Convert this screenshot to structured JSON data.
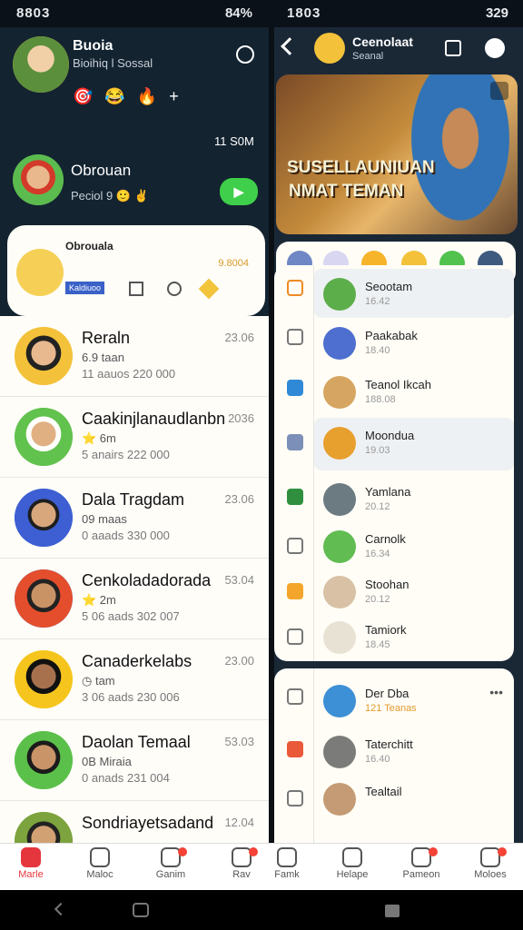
{
  "status": {
    "left_time": "8803",
    "right_time": "1803",
    "battery_left": "84%",
    "battery_right": "329"
  },
  "left_profile": {
    "name": "Buoia",
    "subtitle": "Bioihiq l Sossal",
    "emoji": "🎯 😂 🔥 +",
    "label_right": "11 S0M",
    "name2": "Obrouan",
    "subtitle2": "Peciol 9 🙂 ✌",
    "button": "▶"
  },
  "highlight": {
    "title": "Obrouala",
    "count": "9.8004",
    "tag": "Kaldiuoo"
  },
  "chats": [
    {
      "name": "Reraln",
      "line1": "6.9 taan",
      "line2": "11 aauos 220 000",
      "time": "23.06",
      "color": "#f3c23a"
    },
    {
      "name": "Caakinjlanaudlanbn ,",
      "line1": "⭐ 6m",
      "line2": "5 anairs 222 000",
      "time": "2036",
      "color": "#62c24e"
    },
    {
      "name": "Dala Tragdam",
      "line1": "09 maas",
      "line2": "0 aaads 330 000",
      "time": "23.06",
      "color": "#3d5fd3"
    },
    {
      "name": "Cenkoladadorada",
      "line1": "⭐ 2m",
      "line2": "5 06 aads 302 007",
      "time": "53.04",
      "color": "#2d7fd8"
    },
    {
      "name": "Canaderkelabs",
      "line1": "◷ tam",
      "line2": "3 06 aads 230 006",
      "time": "23.00",
      "color": "#f5c51d"
    },
    {
      "name": "Daolan Temaal",
      "line1": "0B Miraia",
      "line2": "0 anads 231 004",
      "time": "53.03",
      "color": "#5bc04a"
    },
    {
      "name": "Sondriayetsadand",
      "line1": "",
      "line2": "",
      "time": "12.04",
      "color": "#7ca33d"
    }
  ],
  "right_header": {
    "name": "Ceenolaat",
    "subtitle": "Seanal"
  },
  "video": {
    "title1": "SUSELLAUNIUAN",
    "title2": "NMAT TEMAN"
  },
  "contacts": [
    {
      "name": "Seootam",
      "time": "16.42"
    },
    {
      "name": "Paakabak",
      "time": "18.40"
    },
    {
      "name": "Teanol Ikcah",
      "time": "188.08"
    },
    {
      "name": "Moondua",
      "time": "19.03"
    },
    {
      "name": "Yamlana",
      "time": "20.12"
    },
    {
      "name": "Carnolk",
      "time": "16.34"
    },
    {
      "name": "Stoohan",
      "time": "20.12"
    },
    {
      "name": "Tamiork",
      "time": "18.45"
    }
  ],
  "contacts2": [
    {
      "name": "Der Dba",
      "time": "121 Teanas"
    },
    {
      "name": "Taterchitt",
      "time": "16.40"
    },
    {
      "name": "Tealtail",
      "time": ""
    }
  ],
  "nav": [
    {
      "label": "Marle",
      "active": true
    },
    {
      "label": "Maloc",
      "active": false
    },
    {
      "label": "Ganim",
      "active": false
    },
    {
      "label": "Rav",
      "active": false
    },
    {
      "label": "Famk",
      "active": false
    },
    {
      "label": "Helape",
      "active": false
    },
    {
      "label": "Pameon",
      "active": false
    },
    {
      "label": "Moloes",
      "active": false
    }
  ]
}
